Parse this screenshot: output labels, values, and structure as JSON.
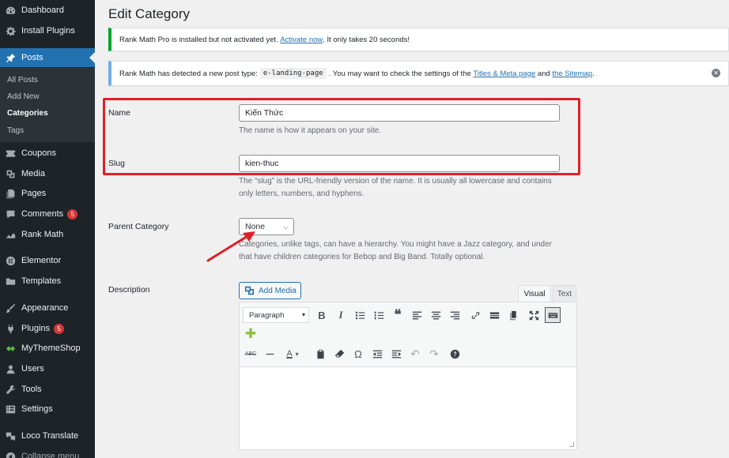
{
  "sidebar": {
    "items": [
      {
        "label": "Dashboard",
        "icon": "dashboard-icon"
      },
      {
        "label": "Install Plugins",
        "icon": "gear-icon"
      },
      {
        "label": "Posts",
        "icon": "pin-icon"
      },
      {
        "label": "Coupons",
        "icon": "coupon-icon"
      },
      {
        "label": "Media",
        "icon": "media-icon"
      },
      {
        "label": "Pages",
        "icon": "pages-icon"
      },
      {
        "label": "Comments",
        "icon": "comment-icon",
        "badge": "5"
      },
      {
        "label": "Rank Math",
        "icon": "chart-icon"
      },
      {
        "label": "Elementor",
        "icon": "elementor-icon"
      },
      {
        "label": "Templates",
        "icon": "folder-icon"
      },
      {
        "label": "Appearance",
        "icon": "brush-icon"
      },
      {
        "label": "Plugins",
        "icon": "plug-icon",
        "badge": "5"
      },
      {
        "label": "MyThemeShop",
        "icon": "mythemeshop-icon"
      },
      {
        "label": "Users",
        "icon": "user-icon"
      },
      {
        "label": "Tools",
        "icon": "wrench-icon"
      },
      {
        "label": "Settings",
        "icon": "settings-icon"
      },
      {
        "label": "Loco Translate",
        "icon": "translate-icon"
      },
      {
        "label": "Collapse menu",
        "icon": "collapse-icon"
      }
    ],
    "posts_submenu": [
      "All Posts",
      "Add New",
      "Categories",
      "Tags"
    ]
  },
  "page": {
    "title": "Edit Category"
  },
  "notices": {
    "success": {
      "text_before": "Rank Math Pro is installed but not activated yet.",
      "link": "Activate now",
      "text_after": ". It only takes 20 seconds!"
    },
    "info": {
      "text_before": "Rank Math has detected a new post type:",
      "code": "e-landing-page",
      "text_middle": ". You may want to check the settings of the",
      "link1": "Titles & Meta page",
      "text_and": "and",
      "link2": "the Sitemap",
      "text_end": "."
    }
  },
  "form": {
    "name_label": "Name",
    "name_value": "Kiến Thức",
    "name_desc": "The name is how it appears on your site.",
    "slug_label": "Slug",
    "slug_value": "kien-thuc",
    "slug_desc": "The “slug” is the URL-friendly version of the name. It is usually all lowercase and contains only letters, numbers, and hyphens.",
    "parent_label": "Parent Category",
    "parent_value": "None",
    "parent_desc": "Categories, unlike tags, can have a hierarchy. You might have a Jazz category, and under that have children categories for Bebop and Big Band. Totally optional.",
    "description_label": "Description"
  },
  "editor": {
    "add_media_label": "Add Media",
    "tab_visual": "Visual",
    "tab_text": "Text",
    "format_value": "Paragraph"
  },
  "colors": {
    "sidebar_bg": "#1d2327",
    "active": "#2271b1",
    "highlight": "#e01f26"
  }
}
